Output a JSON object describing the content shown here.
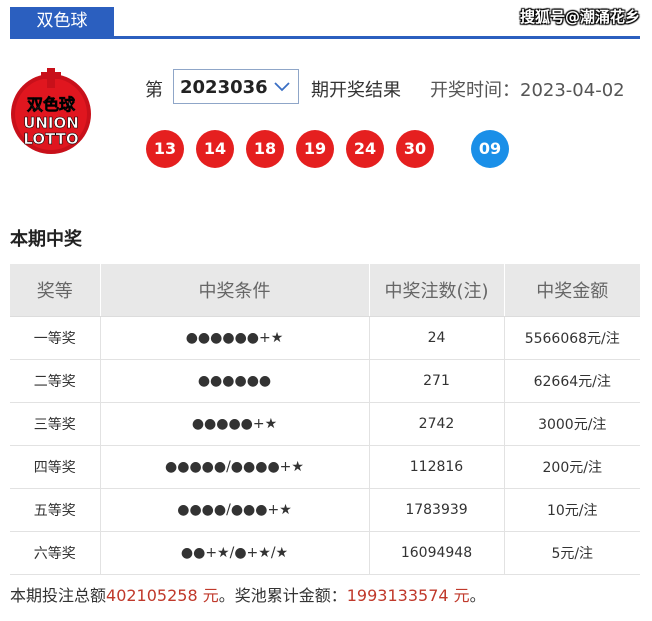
{
  "header": {
    "tab_label": "双色球",
    "watermark": "搜狐号@潮涌花乡"
  },
  "logo": {
    "main_text": "双色球",
    "line1": "UNION",
    "line2": "LOTTO"
  },
  "draw": {
    "prefix": "第",
    "issue": "2023036",
    "suffix": "期开奖结果",
    "time": "开奖时间：2023-04-02",
    "red_balls": [
      "13",
      "14",
      "18",
      "19",
      "24",
      "30"
    ],
    "blue_balls": [
      "09"
    ]
  },
  "colors": {
    "red_ball": "#e51f1f",
    "blue_ball": "#1a8fe8",
    "accent": "#2b5fbf",
    "highlight": "#c0392b"
  },
  "prize": {
    "title": "本期中奖",
    "headers": [
      "奖等",
      "中奖条件",
      "中奖注数(注)",
      "中奖金额"
    ],
    "rows": [
      [
        "一等奖",
        "●●●●●●+★",
        "24",
        "5566068元/注"
      ],
      [
        "二等奖",
        "●●●●●●",
        "271",
        "62664元/注"
      ],
      [
        "三等奖",
        "●●●●●+★",
        "2742",
        "3000元/注"
      ],
      [
        "四等奖",
        "●●●●●/●●●●+★",
        "112816",
        "200元/注"
      ],
      [
        "五等奖",
        "●●●●/●●●+★",
        "1783939",
        "10元/注"
      ],
      [
        "六等奖",
        "●●+★/●+★/★",
        "16094948",
        "5元/注"
      ]
    ]
  },
  "footer": {
    "sales_label": "本期投注总额",
    "sales_value": "402105258 元",
    "pool_label": "。奖池累计金额：",
    "pool_value": "1993133574 元",
    "end": "。"
  }
}
